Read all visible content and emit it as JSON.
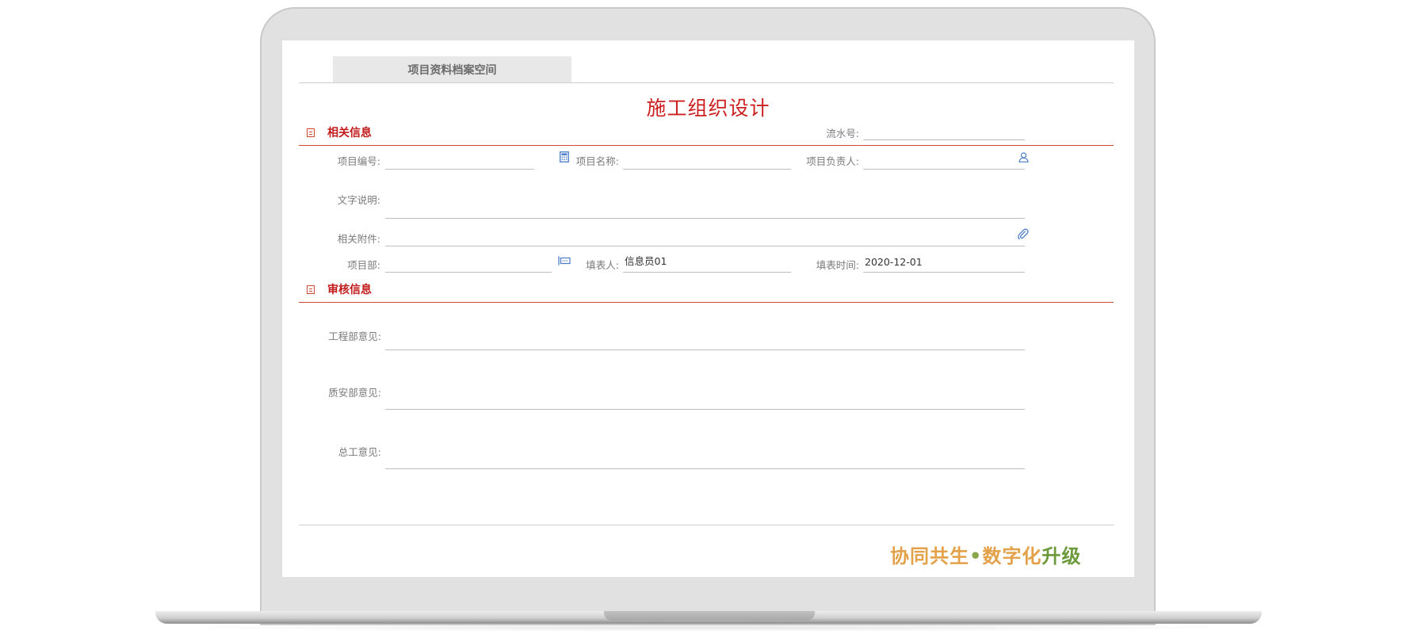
{
  "tab": {
    "label": "项目资料档案空间"
  },
  "form": {
    "title": "施工组织设计"
  },
  "related": {
    "section_title": "相关信息",
    "serial_label": "流水号:",
    "serial_value": "",
    "project_code_label": "项目编号:",
    "project_code_value": "",
    "project_name_label": "项目名称:",
    "project_name_value": "",
    "project_manager_label": "项目负责人:",
    "project_manager_value": "",
    "description_label": "文字说明:",
    "description_value": "",
    "attachment_label": "相关附件:",
    "department_label": "项目部:",
    "department_value": "",
    "filler_label": "填表人:",
    "filler_value": "信息员01",
    "fill_date_label": "填表时间:",
    "fill_date_value": "2020-12-01"
  },
  "review": {
    "section_title": "审核信息",
    "engineering_label": "工程部意见:",
    "engineering_value": "",
    "quality_safety_label": "质安部意见:",
    "quality_safety_value": "",
    "chief_engineer_label": "总工意见:",
    "chief_engineer_value": ""
  },
  "slogan": {
    "part1": "协同共生",
    "dot": "•",
    "part2": "数字化",
    "part3": "升级"
  },
  "icons": {
    "project_code_icon": "calculator-icon",
    "project_manager_icon": "user-icon",
    "attachment_icon": "paperclip-icon",
    "department_icon": "department-picker-icon",
    "section_icon": "list-icon"
  },
  "colors": {
    "accent_red": "#cc1f1f",
    "section_line": "#d24a35",
    "icon_blue": "#4a7cc8",
    "slogan_orange": "#e3a24a",
    "slogan_green": "#6c9a3b"
  }
}
